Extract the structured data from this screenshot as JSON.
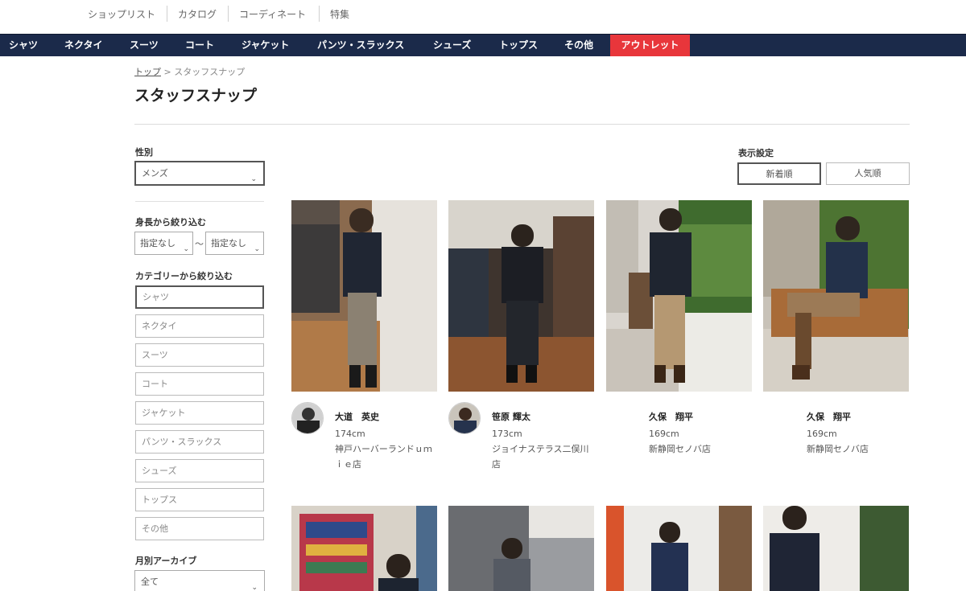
{
  "top_links": [
    "ショップリスト",
    "カタログ",
    "コーディネート",
    "特集"
  ],
  "nav": {
    "items": [
      "シャツ",
      "ネクタイ",
      "スーツ",
      "コート",
      "ジャケット",
      "パンツ・スラックス",
      "シューズ",
      "トップス",
      "その他"
    ],
    "outlet": "アウトレット"
  },
  "breadcrumb": {
    "home": "トップ",
    "separator": ">",
    "current": "スタッフスナップ"
  },
  "page_title": "スタッフスナップ",
  "filters": {
    "gender_label": "性別",
    "gender_value": "メンズ",
    "height_label": "身長から絞り込む",
    "height_from": "指定なし",
    "height_to": "指定なし",
    "height_separator": "〜",
    "category_label": "カテゴリーから絞り込む",
    "categories": [
      "シャツ",
      "ネクタイ",
      "スーツ",
      "コート",
      "ジャケット",
      "パンツ・スラックス",
      "シューズ",
      "トップス",
      "その他"
    ],
    "archive_label": "月別アーカイブ",
    "archive_value": "全て"
  },
  "display": {
    "label": "表示設定",
    "sort_new": "新着順",
    "sort_popular": "人気順"
  },
  "snaps": [
    {
      "name": "大道　英史",
      "height": "174cm",
      "shop": "神戸ハーバーランドｕｍｉｅ店"
    },
    {
      "name": "笹原 輝太",
      "height": "173cm",
      "shop": "ジョイナステラス二俣川店"
    },
    {
      "name": "久保　翔平",
      "height": "169cm",
      "shop": "新静岡セノバ店"
    },
    {
      "name": "久保　翔平",
      "height": "169cm",
      "shop": "新静岡セノバ店"
    }
  ],
  "colors": {
    "nav_bg": "#1b2a4a",
    "outlet_bg": "#e8363b"
  }
}
